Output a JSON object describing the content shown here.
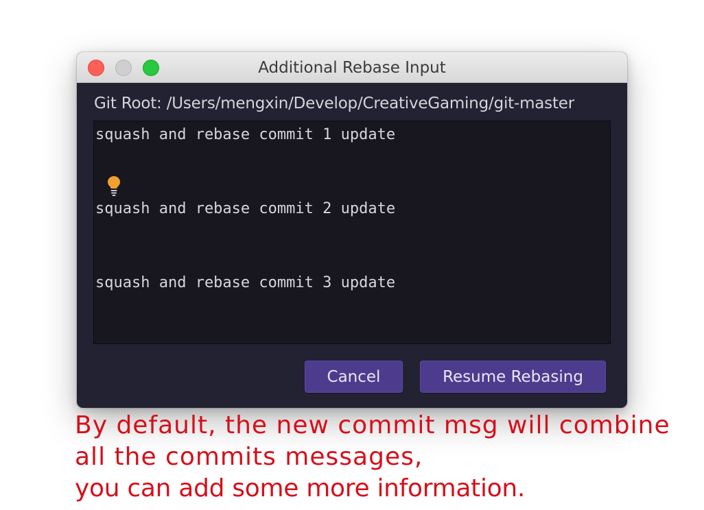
{
  "window": {
    "title": "Additional Rebase Input"
  },
  "git_root": {
    "label": "Git Root: /Users/mengxin/Develop/CreativeGaming/git-master"
  },
  "editor": {
    "lines": [
      "squash and rebase commit 1 update",
      "squash and rebase commit 2 update",
      "squash and rebase commit 3 update"
    ]
  },
  "buttons": {
    "cancel_label": "Cancel",
    "resume_label": "Resume Rebasing"
  },
  "annotation": {
    "line1": "By default, the new commit msg will combine",
    "line2": "all the commits messages,",
    "line3": "you can add some more information."
  },
  "colors": {
    "accent_button": "#4d3c8e",
    "annotation_text": "#d60f1a",
    "bulb": "#f0a030"
  },
  "icons": {
    "intention": "lightbulb-icon"
  }
}
